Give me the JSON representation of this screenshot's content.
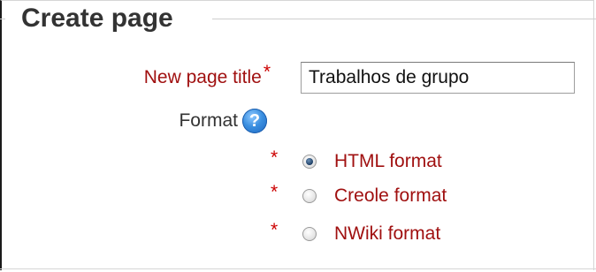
{
  "fieldset": {
    "legend": "Create page"
  },
  "page_title": {
    "label": "New page title",
    "required_marker": "*",
    "value": "Trabalhos de grupo"
  },
  "format": {
    "label": "Format",
    "help_icon": "help-icon",
    "help_glyph": "?",
    "options": [
      {
        "label": "HTML format",
        "required_marker": "*",
        "checked": true
      },
      {
        "label": "Creole format",
        "required_marker": "*",
        "checked": false
      },
      {
        "label": "NWiki format",
        "required_marker": "*",
        "checked": false
      }
    ]
  },
  "colors": {
    "label_red": "#a01010",
    "required_red": "#cc0000",
    "help_blue": "#3a8fe0"
  }
}
